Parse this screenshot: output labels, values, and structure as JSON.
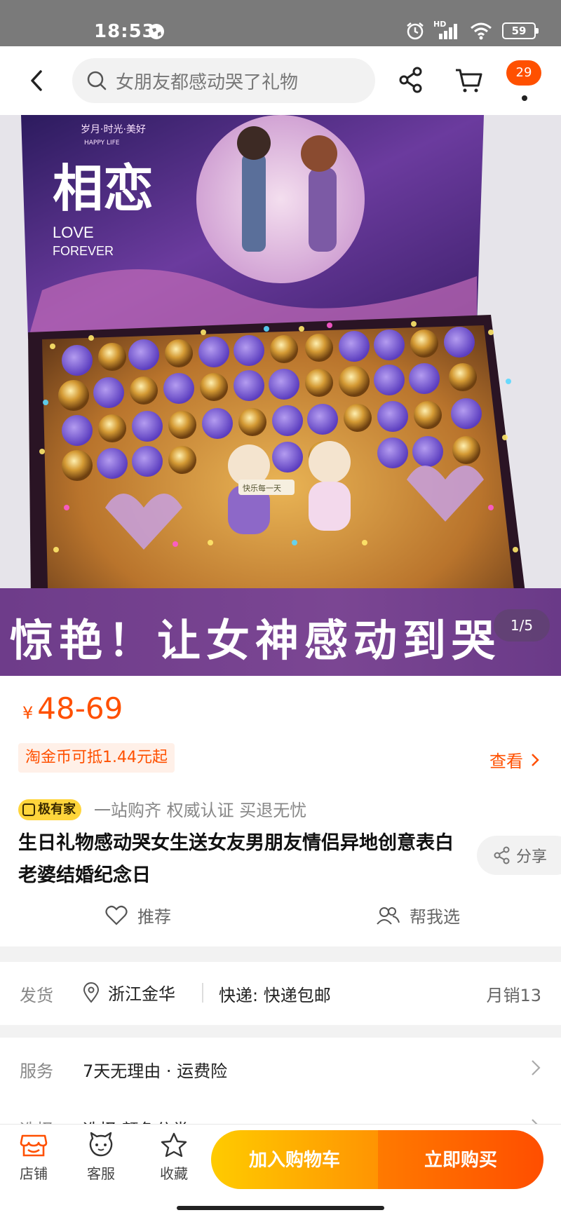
{
  "status_bar": {
    "time": "18:53",
    "network": "HD",
    "battery": "59"
  },
  "top_nav": {
    "search_text": "女朋友都感动哭了礼物",
    "cart_badge": "29"
  },
  "hero": {
    "box_title": "相恋",
    "box_subtitle_1": "LOVE",
    "box_subtitle_2": "FOREVER",
    "box_top_text": "岁月·时光·美好",
    "box_top_text_en": "HAPPY LIFE",
    "bear_sign": "快乐每一天",
    "banner_text": "惊艳！让女神感动到哭",
    "image_counter": "1/5"
  },
  "product": {
    "currency": "¥",
    "price_range": "48-69",
    "coin_text": "淘金币可抵1.44元起",
    "view_label": "查看",
    "brand_badge": "极有家",
    "slogan": "一站购齐 权威认证 买退无忧",
    "title": "生日礼物感动哭女生送女友男朋友情侣异地创意表白老婆结婚纪念日",
    "share_label": "分享",
    "recommend_label": "推荐",
    "help_choose_label": "帮我选"
  },
  "shipping": {
    "label": "发货",
    "location": "浙江金华",
    "express": "快递: 快递包邮",
    "monthly_sales": "月销13"
  },
  "service": {
    "label": "服务",
    "value": "7天无理由 · 运费险",
    "select_label": "选择",
    "select_value": "选择 颜色分类"
  },
  "bottom_bar": {
    "store_label": "店铺",
    "customer_service_label": "客服",
    "favorite_label": "收藏",
    "add_cart_label": "加入购物车",
    "buy_now_label": "立即购买"
  },
  "colors": {
    "accent": "#ff5000",
    "banner_purple": "#7b4693",
    "cart_yellow": "#ffcb00"
  }
}
